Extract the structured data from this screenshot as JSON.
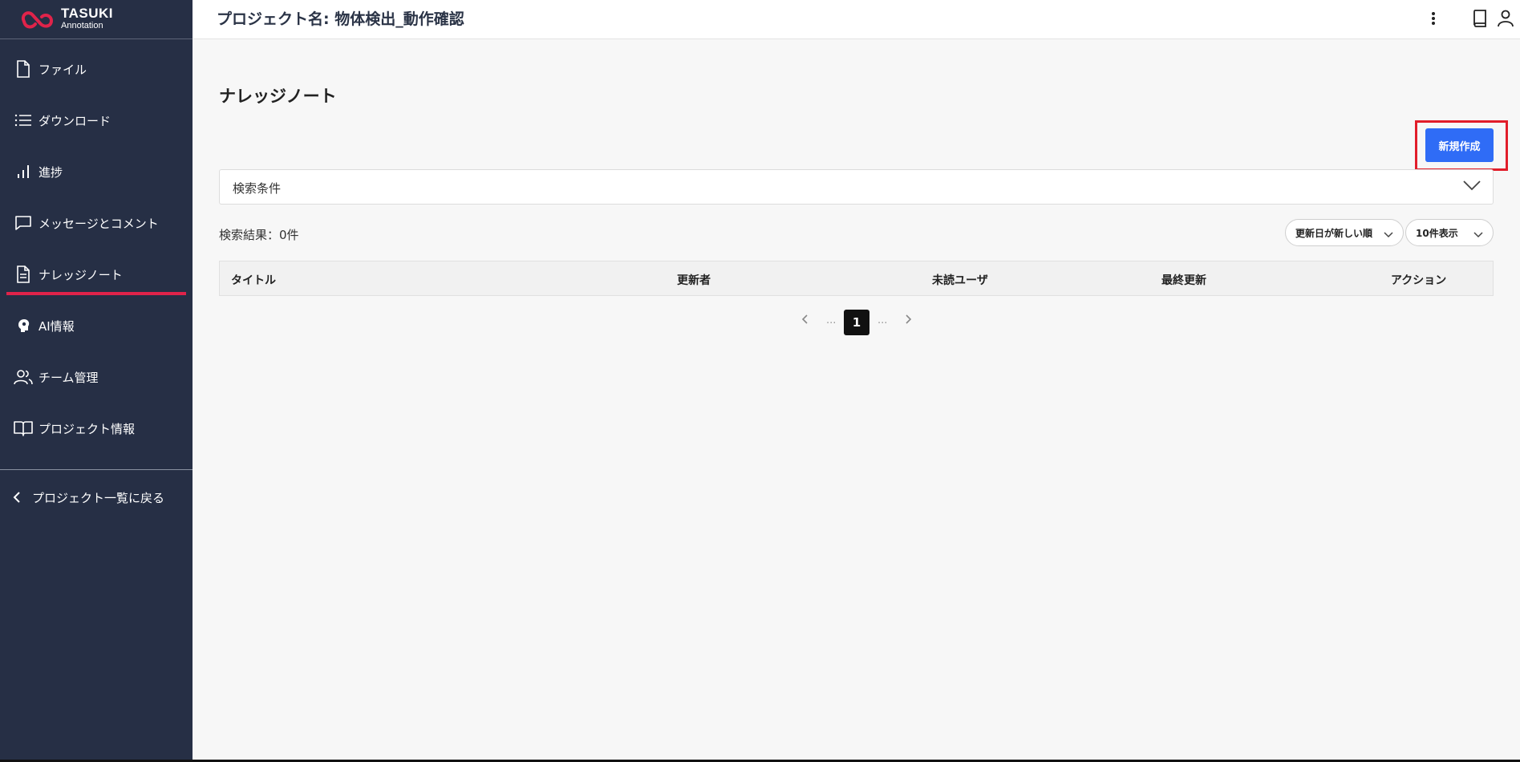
{
  "brand": {
    "line1": "TASUKI",
    "line2": "Annotation",
    "logo_color": "#e0234a"
  },
  "sidebar": {
    "items": [
      {
        "label": "ファイル",
        "icon": "file-icon"
      },
      {
        "label": "ダウンロード",
        "icon": "list-icon"
      },
      {
        "label": "進捗",
        "icon": "bar-chart-icon"
      },
      {
        "label": "メッセージとコメント",
        "icon": "message-icon"
      },
      {
        "label": "ナレッジノート",
        "icon": "document-icon",
        "active": true
      },
      {
        "label": "AI情報",
        "icon": "brain-icon"
      },
      {
        "label": "チーム管理",
        "icon": "users-icon"
      },
      {
        "label": "プロジェクト情報",
        "icon": "book-open-icon"
      }
    ],
    "back_label": "プロジェクト一覧に戻る"
  },
  "header": {
    "project_title": "プロジェクト名: 物体検出_動作確認",
    "icons": [
      "more-vertical-icon",
      "book-icon",
      "user-icon"
    ]
  },
  "main": {
    "page_title": "ナレッジノート",
    "new_button_label": "新規作成",
    "search_label": "検索条件",
    "result_count": "検索結果：0件",
    "sort_select": "更新日が新しい順",
    "page_size_select": "10件表示",
    "table_columns": [
      "タイトル",
      "更新者",
      "未読ユーザ",
      "最終更新",
      "アクション"
    ],
    "pagination": {
      "current_page": "1",
      "dots": "..."
    }
  },
  "colors": {
    "sidebar_bg": "#262f45",
    "accent": "#2f6cf6",
    "active_underline": "#e0234a",
    "highlight": "#e11d2a"
  }
}
